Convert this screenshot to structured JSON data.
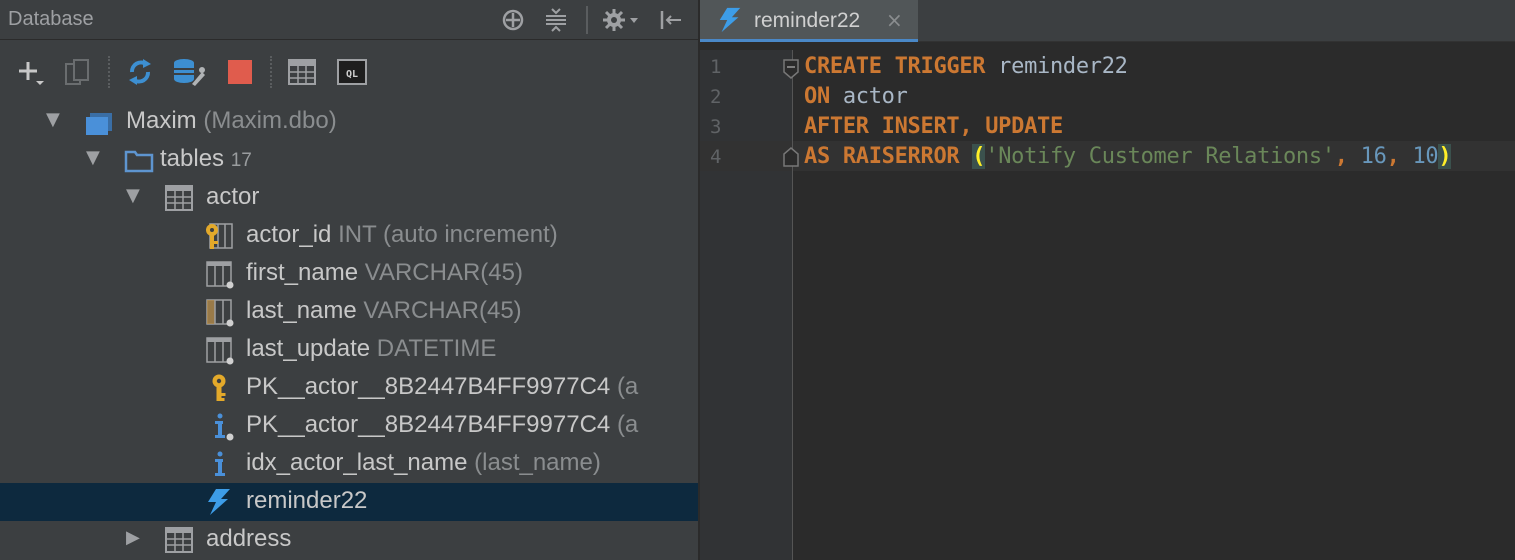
{
  "panel": {
    "title": "Database",
    "header_icons": [
      "crosshair-icon",
      "collapse-all-icon",
      "gear-icon",
      "hide-panel-icon"
    ],
    "toolbar": [
      "add-icon",
      "copy-icon",
      "refresh-icon",
      "schema-tools-icon",
      "stop-icon",
      "table-editor-icon",
      "console-icon"
    ],
    "console_icon_text": "QL"
  },
  "tree": {
    "datasource": {
      "name": "Maxim",
      "detail": "(Maxim.dbo)"
    },
    "tables_folder": {
      "name": "tables",
      "count": "17"
    },
    "table": {
      "name": "actor"
    },
    "columns": [
      {
        "name": "actor_id",
        "type": "INT (auto increment)",
        "icon": "primary-key-column-icon"
      },
      {
        "name": "first_name",
        "type": "VARCHAR(45)",
        "icon": "column-icon"
      },
      {
        "name": "last_name",
        "type": "VARCHAR(45)",
        "icon": "indexed-column-icon"
      },
      {
        "name": "last_update",
        "type": "DATETIME",
        "icon": "column-icon"
      }
    ],
    "keys": [
      {
        "name": "PK__actor__8B2447B4FF9977C4",
        "detail": "(a",
        "icon": "key-icon"
      },
      {
        "name": "PK__actor__8B2447B4FF9977C4",
        "detail": "(a",
        "icon": "index-icon"
      },
      {
        "name": "idx_actor_last_name",
        "detail": "(last_name)",
        "icon": "index-icon"
      }
    ],
    "trigger": {
      "name": "reminder22",
      "icon": "trigger-icon"
    },
    "next_table": {
      "name": "address"
    }
  },
  "editor": {
    "tab": {
      "label": "reminder22",
      "close": "×"
    },
    "line_numbers": [
      "1",
      "2",
      "3",
      "4"
    ],
    "lines": [
      {
        "kw1": "CREATE TRIGGER",
        "rest": " reminder22"
      },
      {
        "kw1": "ON",
        "rest": " actor"
      },
      {
        "kw1": "AFTER INSERT, UPDATE",
        "rest": ""
      },
      {
        "kw1": "AS RAISERROR",
        "sp": " ",
        "open": "(",
        "str": "'Notify Customer Relations'",
        "c1": ", ",
        "n1": "16",
        "c2": ", ",
        "n2": "10",
        "close": ")"
      }
    ]
  },
  "colors": {
    "keyword": "#cc7832",
    "string": "#6a8759",
    "number": "#6897bb",
    "selection": "#0d293e",
    "accent": "#4a88c7"
  }
}
